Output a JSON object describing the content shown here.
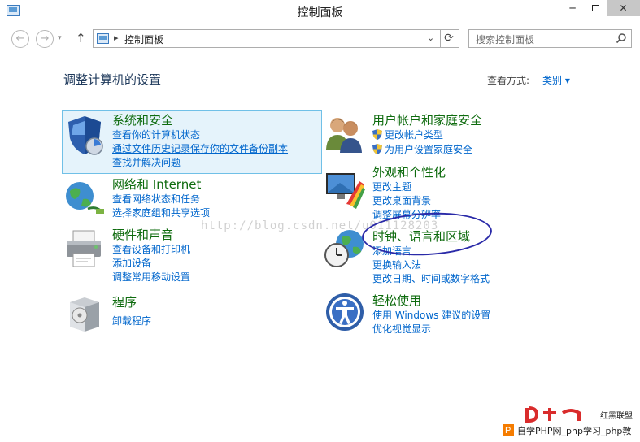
{
  "window": {
    "title": "控制面板",
    "minimize": "─",
    "close": "✕"
  },
  "nav": {
    "back": "←",
    "forward": "→",
    "up": "↑",
    "address_path": "控制面板",
    "refresh": "⟳",
    "search_placeholder": "搜索控制面板"
  },
  "main": {
    "heading": "调整计算机的设置",
    "view_by_label": "查看方式:",
    "view_by_value": "类别 ▾"
  },
  "categories": [
    {
      "title": "系统和安全",
      "icon": "system-security-shield-icon",
      "links": [
        "查看你的计算机状态",
        "通过文件历史记录保存你的文件备份副本",
        "查找并解决问题"
      ]
    },
    {
      "title": "网络和 Internet",
      "icon": "network-globe-icon",
      "links": [
        "查看网络状态和任务",
        "选择家庭组和共享选项"
      ]
    },
    {
      "title": "硬件和声音",
      "icon": "printer-icon",
      "links": [
        "查看设备和打印机",
        "添加设备",
        "调整常用移动设置"
      ]
    },
    {
      "title": "程序",
      "icon": "programs-box-icon",
      "links": [
        "卸载程序"
      ]
    },
    {
      "title": "用户帐户和家庭安全",
      "icon": "users-icon",
      "links": [
        "更改帐户类型",
        "为用户设置家庭安全"
      ]
    },
    {
      "title": "外观和个性化",
      "icon": "appearance-monitor-icon",
      "links": [
        "更改主题",
        "更改桌面背景",
        "调整屏幕分辨率"
      ]
    },
    {
      "title": "时钟、语言和区域",
      "icon": "clock-globe-icon",
      "links": [
        "添加语言",
        "更换输入法",
        "更改日期、时间或数字格式"
      ]
    },
    {
      "title": "轻松使用",
      "icon": "ease-of-access-icon",
      "links": [
        "使用 Windows 建议的设置",
        "优化视觉显示"
      ]
    }
  ],
  "overlay": {
    "watermark": "http://blog.csdn.net/u011128203",
    "logo_text": "自学PHP网_php学习_php教",
    "logo_brand": "红黑联盟"
  },
  "colors": {
    "category_title": "#0e6b0e",
    "link": "#0066cc",
    "hover_background": "#e5f3fb",
    "annotation_ellipse": "#2a2aa8"
  }
}
